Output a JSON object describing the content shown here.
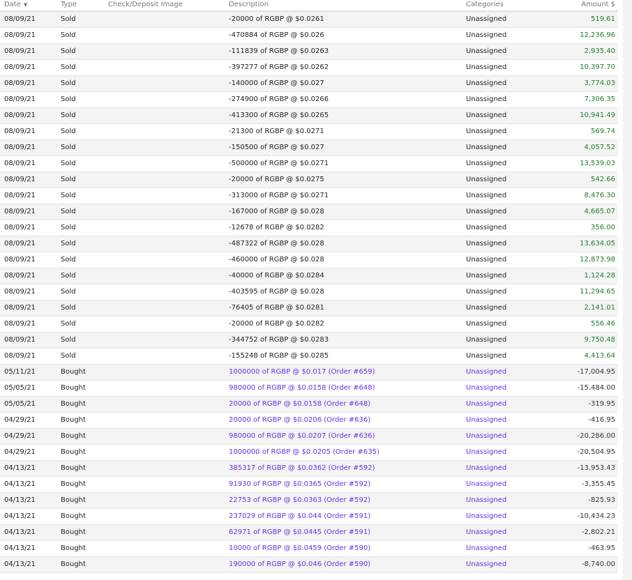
{
  "header": {
    "date": "Date",
    "type": "Type",
    "image": "Check/Deposit Image",
    "description": "Description",
    "categories": "Categories",
    "amount": "Amount $",
    "sort_icon": "▼"
  },
  "colors": {
    "positive": "#1f7a2e",
    "link": "#6a2fe0"
  },
  "rows": [
    {
      "date": "08/09/21",
      "type": "Sold",
      "description": "-20000 of RGBP @ $0.0261",
      "category": "Unassigned",
      "amount": "519.61"
    },
    {
      "date": "08/09/21",
      "type": "Sold",
      "description": "-470884 of RGBP @ $0.026",
      "category": "Unassigned",
      "amount": "12,236.96"
    },
    {
      "date": "08/09/21",
      "type": "Sold",
      "description": "-111839 of RGBP @ $0.0263",
      "category": "Unassigned",
      "amount": "2,935.40"
    },
    {
      "date": "08/09/21",
      "type": "Sold",
      "description": "-397277 of RGBP @ $0.0262",
      "category": "Unassigned",
      "amount": "10,397.70"
    },
    {
      "date": "08/09/21",
      "type": "Sold",
      "description": "-140000 of RGBP @ $0.027",
      "category": "Unassigned",
      "amount": "3,774.03"
    },
    {
      "date": "08/09/21",
      "type": "Sold",
      "description": "-274900 of RGBP @ $0.0266",
      "category": "Unassigned",
      "amount": "7,306.35"
    },
    {
      "date": "08/09/21",
      "type": "Sold",
      "description": "-413300 of RGBP @ $0.0265",
      "category": "Unassigned",
      "amount": "10,941.49"
    },
    {
      "date": "08/09/21",
      "type": "Sold",
      "description": "-21300 of RGBP @ $0.0271",
      "category": "Unassigned",
      "amount": "569.74"
    },
    {
      "date": "08/09/21",
      "type": "Sold",
      "description": "-150500 of RGBP @ $0.027",
      "category": "Unassigned",
      "amount": "4,057.52"
    },
    {
      "date": "08/09/21",
      "type": "Sold",
      "description": "-500000 of RGBP @ $0.0271",
      "category": "Unassigned",
      "amount": "13,539.03"
    },
    {
      "date": "08/09/21",
      "type": "Sold",
      "description": "-20000 of RGBP @ $0.0275",
      "category": "Unassigned",
      "amount": "542.66"
    },
    {
      "date": "08/09/21",
      "type": "Sold",
      "description": "-313000 of RGBP @ $0.0271",
      "category": "Unassigned",
      "amount": "8,476.30"
    },
    {
      "date": "08/09/21",
      "type": "Sold",
      "description": "-167000 of RGBP @ $0.028",
      "category": "Unassigned",
      "amount": "4,665.07"
    },
    {
      "date": "08/09/21",
      "type": "Sold",
      "description": "-12678 of RGBP @ $0.0282",
      "category": "Unassigned",
      "amount": "356.00"
    },
    {
      "date": "08/09/21",
      "type": "Sold",
      "description": "-487322 of RGBP @ $0.028",
      "category": "Unassigned",
      "amount": "13,634.05"
    },
    {
      "date": "08/09/21",
      "type": "Sold",
      "description": "-460000 of RGBP @ $0.028",
      "category": "Unassigned",
      "amount": "12,873.98"
    },
    {
      "date": "08/09/21",
      "type": "Sold",
      "description": "-40000 of RGBP @ $0.0284",
      "category": "Unassigned",
      "amount": "1,124.28"
    },
    {
      "date": "08/09/21",
      "type": "Sold",
      "description": "-403595 of RGBP @ $0.028",
      "category": "Unassigned",
      "amount": "11,294.65"
    },
    {
      "date": "08/09/21",
      "type": "Sold",
      "description": "-76405 of RGBP @ $0.0281",
      "category": "Unassigned",
      "amount": "2,141.01"
    },
    {
      "date": "08/09/21",
      "type": "Sold",
      "description": "-20000 of RGBP @ $0.0282",
      "category": "Unassigned",
      "amount": "556.46"
    },
    {
      "date": "08/09/21",
      "type": "Sold",
      "description": "-344752 of RGBP @ $0.0283",
      "category": "Unassigned",
      "amount": "9,750.48"
    },
    {
      "date": "08/09/21",
      "type": "Sold",
      "description": "-155248 of RGBP @ $0.0285",
      "category": "Unassigned",
      "amount": "4,413.64"
    },
    {
      "date": "05/11/21",
      "type": "Bought",
      "description": "1000000 of RGBP @ $0.017 (Order #659)",
      "category": "Unassigned",
      "amount": "-17,004.95"
    },
    {
      "date": "05/05/21",
      "type": "Bought",
      "description": "980000 of RGBP @ $0.0158 (Order #648)",
      "category": "Unassigned",
      "amount": "-15,484.00"
    },
    {
      "date": "05/05/21",
      "type": "Bought",
      "description": "20000 of RGBP @ $0.0158 (Order #648)",
      "category": "Unassigned",
      "amount": "-319.95"
    },
    {
      "date": "04/29/21",
      "type": "Bought",
      "description": "20000 of RGBP @ $0.0206 (Order #636)",
      "category": "Unassigned",
      "amount": "-416.95"
    },
    {
      "date": "04/29/21",
      "type": "Bought",
      "description": "980000 of RGBP @ $0.0207 (Order #636)",
      "category": "Unassigned",
      "amount": "-20,286.00"
    },
    {
      "date": "04/29/21",
      "type": "Bought",
      "description": "1000000 of RGBP @ $0.0205 (Order #635)",
      "category": "Unassigned",
      "amount": "-20,504.95"
    },
    {
      "date": "04/13/21",
      "type": "Bought",
      "description": "385317 of RGBP @ $0.0362 (Order #592)",
      "category": "Unassigned",
      "amount": "-13,953.43"
    },
    {
      "date": "04/13/21",
      "type": "Bought",
      "description": "91930 of RGBP @ $0.0365 (Order #592)",
      "category": "Unassigned",
      "amount": "-3,355.45"
    },
    {
      "date": "04/13/21",
      "type": "Bought",
      "description": "22753 of RGBP @ $0.0363 (Order #592)",
      "category": "Unassigned",
      "amount": "-825.93"
    },
    {
      "date": "04/13/21",
      "type": "Bought",
      "description": "237029 of RGBP @ $0.044 (Order #591)",
      "category": "Unassigned",
      "amount": "-10,434.23"
    },
    {
      "date": "04/13/21",
      "type": "Bought",
      "description": "62971 of RGBP @ $0.0445 (Order #591)",
      "category": "Unassigned",
      "amount": "-2,802.21"
    },
    {
      "date": "04/13/21",
      "type": "Bought",
      "description": "10000 of RGBP @ $0.0459 (Order #590)",
      "category": "Unassigned",
      "amount": "-463.95"
    },
    {
      "date": "04/13/21",
      "type": "Bought",
      "description": "190000 of RGBP @ $0.046 (Order #590)",
      "category": "Unassigned",
      "amount": "-8,740.00"
    }
  ]
}
